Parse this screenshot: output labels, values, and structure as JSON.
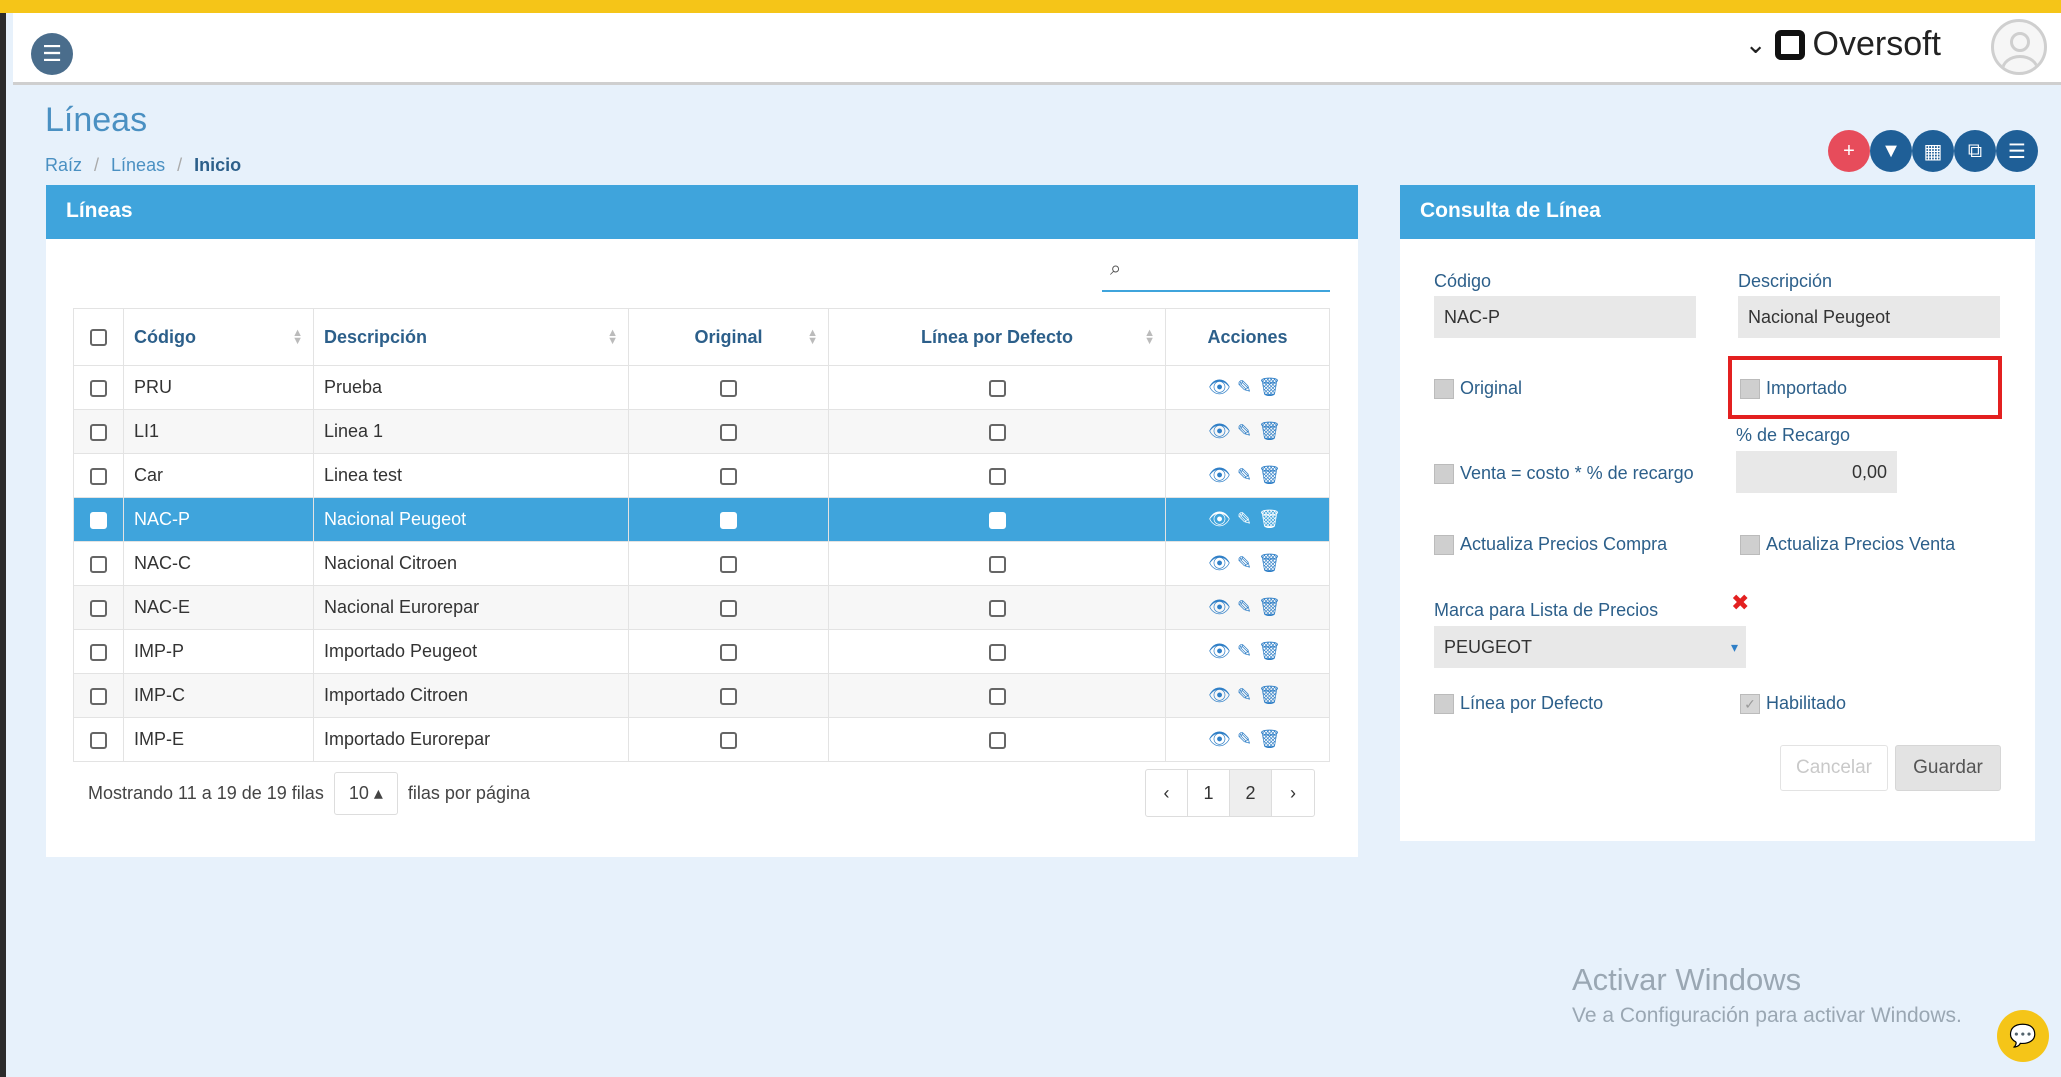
{
  "app": {
    "brand": "Oversoft"
  },
  "page": {
    "title": "Líneas"
  },
  "breadcrumb": [
    "Raíz",
    "Líneas",
    "Inicio"
  ],
  "left_panel": {
    "title": "Líneas",
    "table": {
      "headers": [
        "Código",
        "Descripción",
        "Original",
        "Línea por Defecto",
        "Acciones"
      ],
      "rows": [
        {
          "code": "PRU",
          "desc": "Prueba"
        },
        {
          "code": "LI1",
          "desc": "Linea 1"
        },
        {
          "code": "Car",
          "desc": "Linea test"
        },
        {
          "code": "NAC-P",
          "desc": "Nacional Peugeot"
        },
        {
          "code": "NAC-C",
          "desc": "Nacional Citroen"
        },
        {
          "code": "NAC-E",
          "desc": "Nacional Eurorepar"
        },
        {
          "code": "IMP-P",
          "desc": "Importado Peugeot"
        },
        {
          "code": "IMP-C",
          "desc": "Importado Citroen"
        },
        {
          "code": "IMP-E",
          "desc": "Importado Eurorepar"
        }
      ],
      "selected_index": 3
    },
    "footer": {
      "showing": "Mostrando 11 a 19 de 19 filas",
      "per_page": "10",
      "per_page_label": "filas por página"
    },
    "pager": [
      "‹",
      "1",
      "2",
      "›"
    ]
  },
  "right_panel": {
    "title": "Consulta de Línea",
    "codigo_label": "Código",
    "codigo_value": "NAC-P",
    "descripcion_label": "Descripción",
    "descripcion_value": "Nacional Peugeot",
    "original_label": "Original",
    "importado_label": "Importado",
    "recargo_label": "% de Recargo",
    "recargo_value": "0,00",
    "venta_label": "Venta = costo * % de recargo",
    "act_compra_label": "Actualiza Precios Compra",
    "act_venta_label": "Actualiza Precios Venta",
    "marca_label": "Marca para Lista de Precios",
    "marca_value": "PEUGEOT",
    "linea_defecto_label": "Línea por Defecto",
    "habilitado_label": "Habilitado",
    "cancel_label": "Cancelar",
    "save_label": "Guardar"
  },
  "watermark": {
    "line1": "Activar Windows",
    "line2": "Ve a Configuración para activar Windows."
  },
  "colors": {
    "accent": "#3fa4dc",
    "header_text": "#2c5f8a",
    "highlight": "#e32020"
  }
}
